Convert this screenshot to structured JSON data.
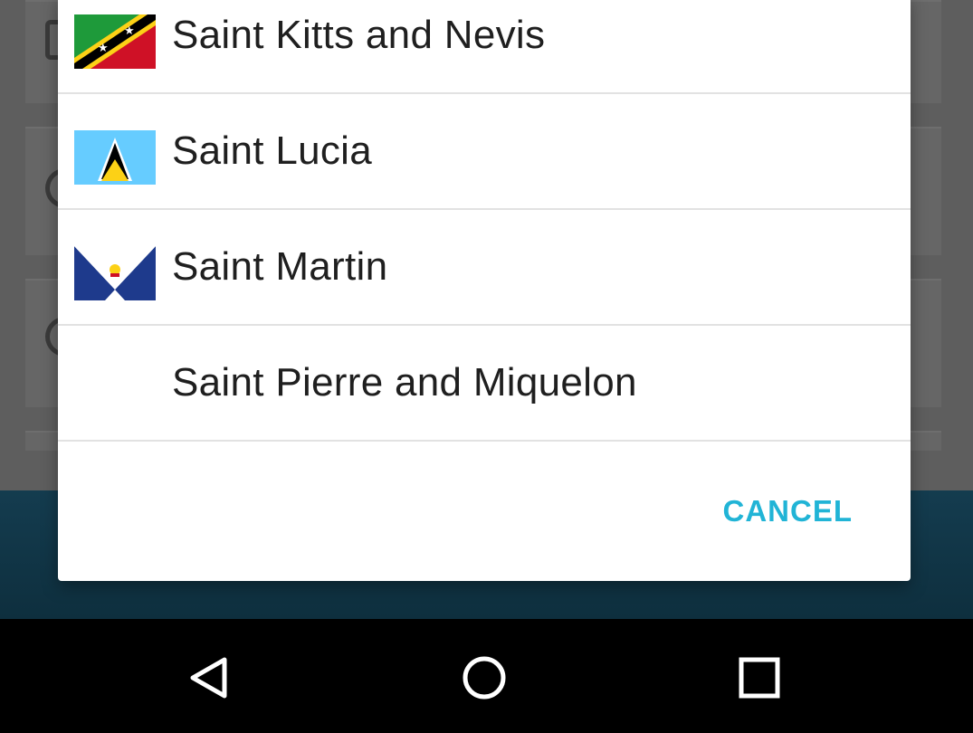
{
  "dialog": {
    "countries": [
      {
        "label": "Saint Kitts and Nevis",
        "flag": "saint-kitts-and-nevis-flag"
      },
      {
        "label": "Saint Lucia",
        "flag": "saint-lucia-flag"
      },
      {
        "label": "Saint Martin",
        "flag": "saint-martin-flag"
      },
      {
        "label": "Saint Pierre and Miquelon",
        "flag": ""
      }
    ],
    "cancel_label": "CANCEL"
  },
  "navbar": {
    "back_icon": "back-triangle-icon",
    "home_icon": "home-circle-icon",
    "recents_icon": "recents-square-icon"
  },
  "colors": {
    "accent": "#21b4d6",
    "scrim_background": "#5f5f5f",
    "app_bottom_bar": "#143c4f",
    "navbar": "#000000"
  }
}
